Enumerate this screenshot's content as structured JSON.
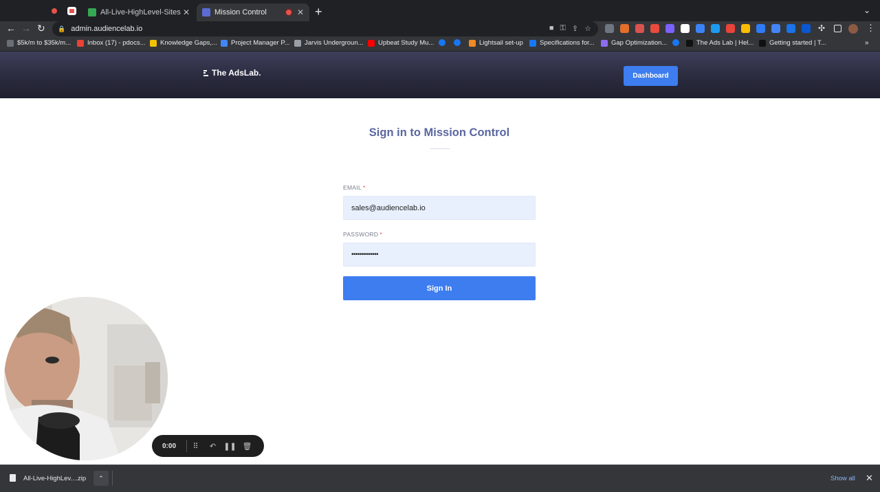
{
  "browser": {
    "tabs": [
      {
        "title": "All-Live-HighLevel-Sites - Goo",
        "favicon_color": "#34a853",
        "active": false
      },
      {
        "title": "Mission Control",
        "favicon_color": "#5b6cd6",
        "active": true
      }
    ],
    "url": "admin.audiencelab.io",
    "bookmarks": [
      {
        "label": "$5k/m to $35k/m...",
        "icon_color": "#6a6f77"
      },
      {
        "label": "Inbox (17) - pdocs...",
        "icon_color": "#ea4335"
      },
      {
        "label": "Knowledge Gaps,...",
        "icon_color": "#f2c200"
      },
      {
        "label": "Project Manager P...",
        "icon_color": "#4285f4"
      },
      {
        "label": "Jarvis Undergroun...",
        "icon_color": "#9aa0a6"
      },
      {
        "label": "Upbeat Study Mu...",
        "icon_color": "#ff0000"
      },
      {
        "label": "Lightsail set-up",
        "icon_color": "#f08a24"
      },
      {
        "label": "Specifications for...",
        "icon_color": "#1877f2"
      },
      {
        "label": "Gap Optimization...",
        "icon_color": "#8e6cf0"
      },
      {
        "label": "The Ads Lab | Hel...",
        "icon_color": "#111111"
      },
      {
        "label": "Getting started | T...",
        "icon_color": "#111111"
      }
    ],
    "extension_colors": [
      "#6e7681",
      "#e36f2a",
      "#d9534f",
      "#e94b3c",
      "#7b61ff",
      "#ffffff",
      "#3b82f6",
      "#1d9bf0",
      "#e8443a",
      "#fbbc04",
      "#2e7bf6",
      "#4285f4",
      "#1a73e8",
      "#0b57d0"
    ]
  },
  "site": {
    "logo_text": "The AdsLab.",
    "dashboard_label": "Dashboard"
  },
  "login": {
    "title": "Sign in to Mission Control",
    "email_label": "EMAIL",
    "email_value": "sales@audiencelab.io",
    "password_label": "PASSWORD",
    "password_mask": "•••••••••••••",
    "required_marker": "*",
    "submit_label": "Sign In"
  },
  "recorder": {
    "time": "0:00"
  },
  "downloads": {
    "file_name": "All-Live-HighLev....zip",
    "show_all": "Show all"
  }
}
